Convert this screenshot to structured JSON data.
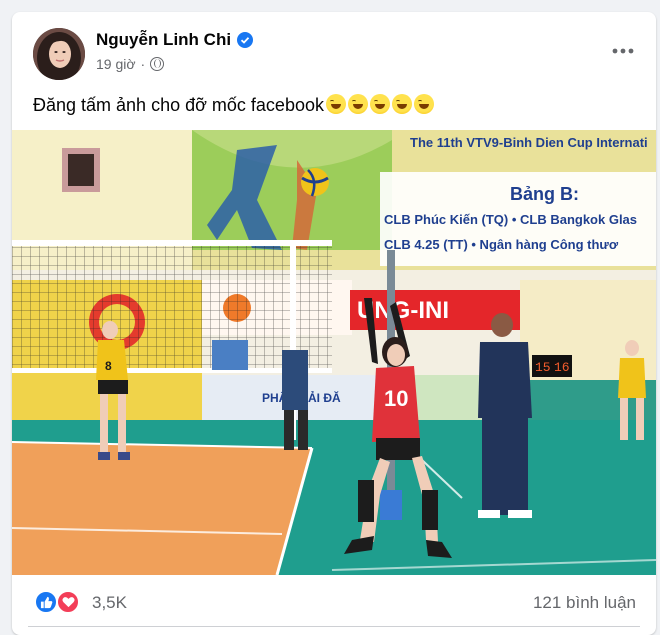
{
  "post": {
    "author": "Nguyễn Linh Chi",
    "time": "19 giờ",
    "separator": "·",
    "caption": "Đăng tấm ảnh cho đỡ mốc facebook",
    "caption_emojis": [
      "grinning-sweat-emoji",
      "grinning-sweat-emoji",
      "grinning-sweat-emoji",
      "grinning-sweat-emoji",
      "grinning-sweat-emoji"
    ],
    "more_icon": "ellipsis-icon"
  },
  "photo": {
    "banner_top": "The 11th VTV9-Binh Dien Cup Internati",
    "bang_title": "Bảng B:",
    "bang_line1": "CLB Phúc Kiến (TQ) • CLB Bangkok Glas",
    "bang_line2": "CLB 4.25 (TT) • Ngân hàng Công thươ",
    "player_number": "10",
    "player_number_far": "8",
    "ad_text": "UNG-INI",
    "board_text": "PHÂN HẢI ĐĂ",
    "score_left": "15",
    "score_right": "16"
  },
  "stats": {
    "reactions_count": "3,5K",
    "comments_count": "121 bình luận"
  },
  "colors": {
    "brand_blue": "#1877f2",
    "love_red": "#f33e58",
    "secondary_text": "#65676b"
  }
}
